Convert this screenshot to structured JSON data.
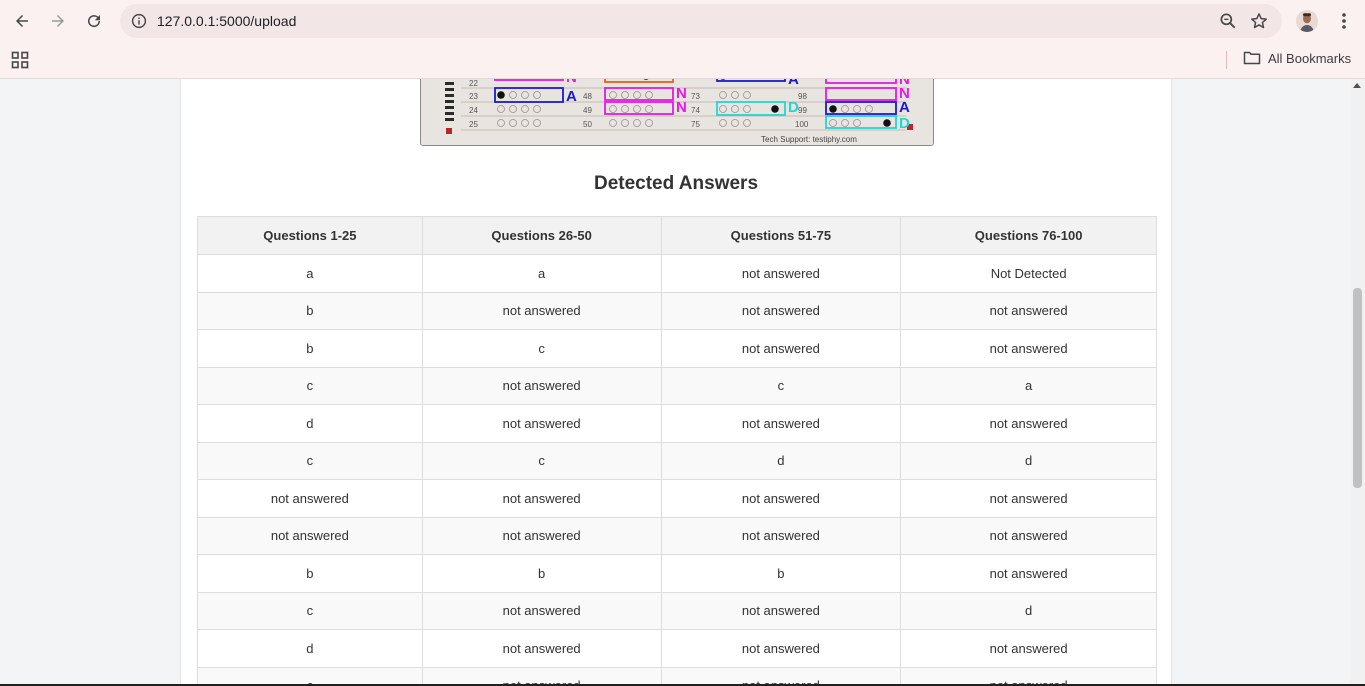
{
  "browser": {
    "url": "127.0.0.1:5000/upload",
    "bookmarks_label": "All Bookmarks"
  },
  "omr_sheet": {
    "numbers_col1": [
      "22",
      "23",
      "24",
      "25"
    ],
    "numbers_col2": [
      "48",
      "49",
      "50"
    ],
    "numbers_col3": [
      "73",
      "74",
      "75"
    ],
    "numbers_col4": [
      "98",
      "99",
      "100"
    ],
    "footer": "Tech Support: testiphy.com"
  },
  "heading": "Detected Answers",
  "table": {
    "headers": [
      "Questions 1-25",
      "Questions 26-50",
      "Questions 51-75",
      "Questions 76-100"
    ],
    "rows": [
      [
        "a",
        "a",
        "not answered",
        "Not Detected"
      ],
      [
        "b",
        "not answered",
        "not answered",
        "not answered"
      ],
      [
        "b",
        "c",
        "not answered",
        "not answered"
      ],
      [
        "c",
        "not answered",
        "c",
        "a"
      ],
      [
        "d",
        "not answered",
        "not answered",
        "not answered"
      ],
      [
        "c",
        "c",
        "d",
        "d"
      ],
      [
        "not answered",
        "not answered",
        "not answered",
        "not answered"
      ],
      [
        "not answered",
        "not answered",
        "not answered",
        "not answered"
      ],
      [
        "b",
        "b",
        "b",
        "not answered"
      ],
      [
        "c",
        "not answered",
        "not answered",
        "d"
      ],
      [
        "d",
        "not answered",
        "not answered",
        "not answered"
      ],
      [
        "c",
        "not answered",
        "not answered",
        "not answered"
      ]
    ]
  }
}
